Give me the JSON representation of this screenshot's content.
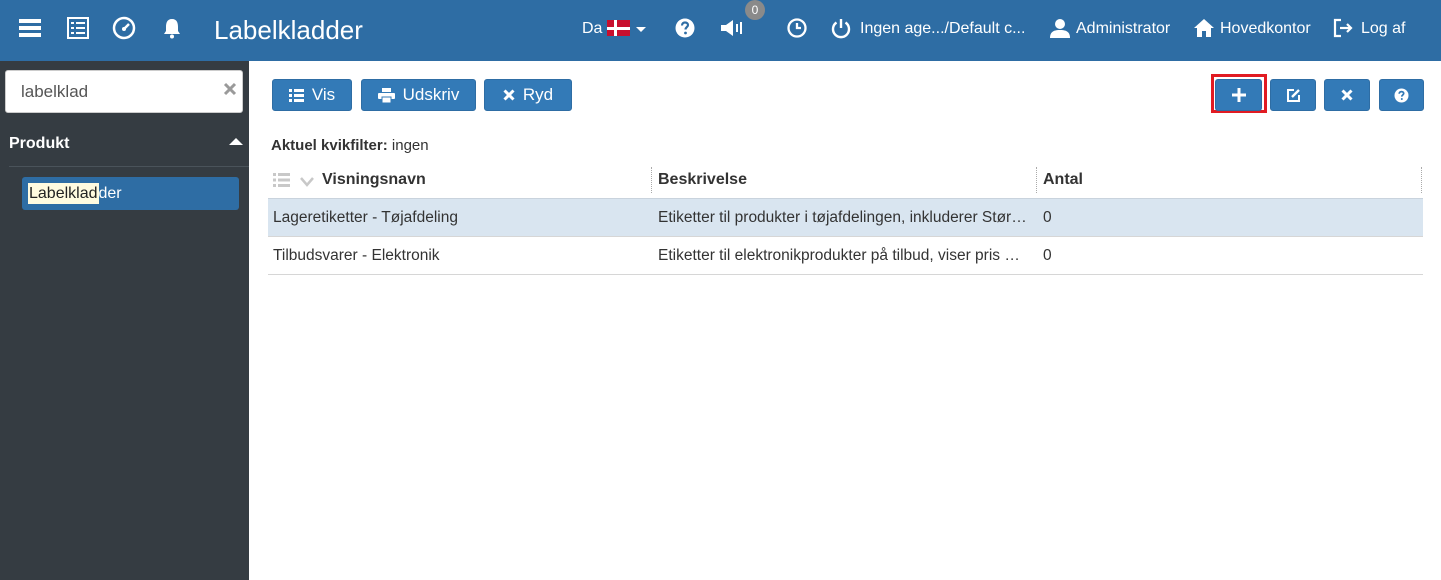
{
  "header": {
    "title": "Labelkladder",
    "language": "Da",
    "notification_count": "0",
    "agent_status": "Ingen age.../Default c...",
    "user": "Administrator",
    "home": "Hovedkontor",
    "logout": "Log af",
    "accent_color": "#2e6da4"
  },
  "sidebar": {
    "search_value": "labelklad",
    "search_placeholder": "",
    "section_title": "Produkt",
    "items": [
      {
        "highlight": "Labelklad",
        "rest": "der"
      }
    ]
  },
  "toolbar": {
    "vis_label": "Vis",
    "udskriv_label": "Udskriv",
    "ryd_label": "Ryd"
  },
  "filter": {
    "label": "Aktuel kvikfilter:",
    "value": "ingen"
  },
  "table": {
    "columns": [
      "Visningsnavn",
      "Beskrivelse",
      "Antal"
    ],
    "rows": [
      {
        "name": "Lageretiketter - Tøjafdeling",
        "description": "Etiketter til produkter i tøjafdelingen, inkluderer Størrelse og farveoplysninger",
        "count": "0",
        "selected": true
      },
      {
        "name": "Tilbudsvarer - Elektronik",
        "description": "Etiketter til elektronikprodukter på tilbud, viser pris og rabat",
        "count": "0",
        "selected": false
      }
    ]
  }
}
